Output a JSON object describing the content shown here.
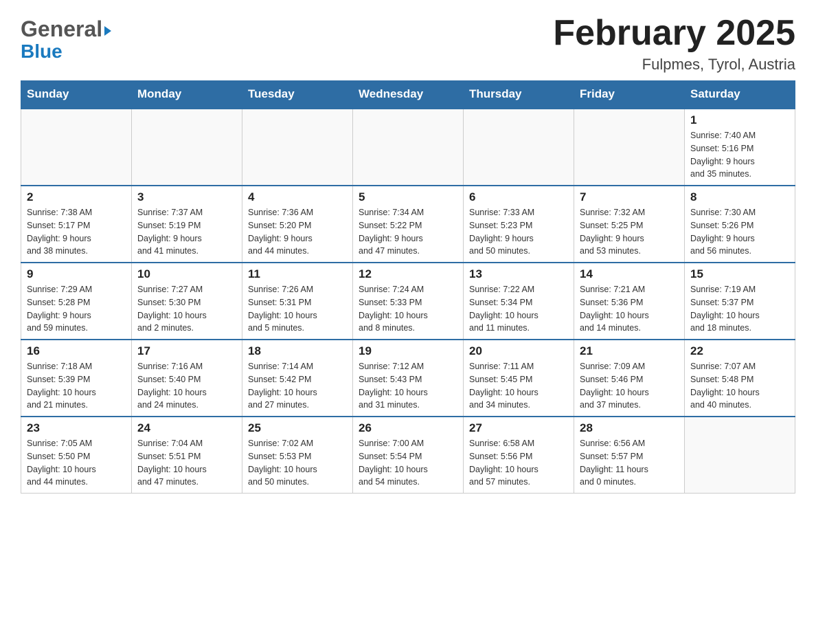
{
  "header": {
    "logo_line1": "General",
    "logo_arrow": "▶",
    "logo_line2": "Blue",
    "month_year": "February 2025",
    "location": "Fulpmes, Tyrol, Austria"
  },
  "days_of_week": [
    "Sunday",
    "Monday",
    "Tuesday",
    "Wednesday",
    "Thursday",
    "Friday",
    "Saturday"
  ],
  "weeks": [
    [
      {
        "day": "",
        "info": ""
      },
      {
        "day": "",
        "info": ""
      },
      {
        "day": "",
        "info": ""
      },
      {
        "day": "",
        "info": ""
      },
      {
        "day": "",
        "info": ""
      },
      {
        "day": "",
        "info": ""
      },
      {
        "day": "1",
        "info": "Sunrise: 7:40 AM\nSunset: 5:16 PM\nDaylight: 9 hours\nand 35 minutes."
      }
    ],
    [
      {
        "day": "2",
        "info": "Sunrise: 7:38 AM\nSunset: 5:17 PM\nDaylight: 9 hours\nand 38 minutes."
      },
      {
        "day": "3",
        "info": "Sunrise: 7:37 AM\nSunset: 5:19 PM\nDaylight: 9 hours\nand 41 minutes."
      },
      {
        "day": "4",
        "info": "Sunrise: 7:36 AM\nSunset: 5:20 PM\nDaylight: 9 hours\nand 44 minutes."
      },
      {
        "day": "5",
        "info": "Sunrise: 7:34 AM\nSunset: 5:22 PM\nDaylight: 9 hours\nand 47 minutes."
      },
      {
        "day": "6",
        "info": "Sunrise: 7:33 AM\nSunset: 5:23 PM\nDaylight: 9 hours\nand 50 minutes."
      },
      {
        "day": "7",
        "info": "Sunrise: 7:32 AM\nSunset: 5:25 PM\nDaylight: 9 hours\nand 53 minutes."
      },
      {
        "day": "8",
        "info": "Sunrise: 7:30 AM\nSunset: 5:26 PM\nDaylight: 9 hours\nand 56 minutes."
      }
    ],
    [
      {
        "day": "9",
        "info": "Sunrise: 7:29 AM\nSunset: 5:28 PM\nDaylight: 9 hours\nand 59 minutes."
      },
      {
        "day": "10",
        "info": "Sunrise: 7:27 AM\nSunset: 5:30 PM\nDaylight: 10 hours\nand 2 minutes."
      },
      {
        "day": "11",
        "info": "Sunrise: 7:26 AM\nSunset: 5:31 PM\nDaylight: 10 hours\nand 5 minutes."
      },
      {
        "day": "12",
        "info": "Sunrise: 7:24 AM\nSunset: 5:33 PM\nDaylight: 10 hours\nand 8 minutes."
      },
      {
        "day": "13",
        "info": "Sunrise: 7:22 AM\nSunset: 5:34 PM\nDaylight: 10 hours\nand 11 minutes."
      },
      {
        "day": "14",
        "info": "Sunrise: 7:21 AM\nSunset: 5:36 PM\nDaylight: 10 hours\nand 14 minutes."
      },
      {
        "day": "15",
        "info": "Sunrise: 7:19 AM\nSunset: 5:37 PM\nDaylight: 10 hours\nand 18 minutes."
      }
    ],
    [
      {
        "day": "16",
        "info": "Sunrise: 7:18 AM\nSunset: 5:39 PM\nDaylight: 10 hours\nand 21 minutes."
      },
      {
        "day": "17",
        "info": "Sunrise: 7:16 AM\nSunset: 5:40 PM\nDaylight: 10 hours\nand 24 minutes."
      },
      {
        "day": "18",
        "info": "Sunrise: 7:14 AM\nSunset: 5:42 PM\nDaylight: 10 hours\nand 27 minutes."
      },
      {
        "day": "19",
        "info": "Sunrise: 7:12 AM\nSunset: 5:43 PM\nDaylight: 10 hours\nand 31 minutes."
      },
      {
        "day": "20",
        "info": "Sunrise: 7:11 AM\nSunset: 5:45 PM\nDaylight: 10 hours\nand 34 minutes."
      },
      {
        "day": "21",
        "info": "Sunrise: 7:09 AM\nSunset: 5:46 PM\nDaylight: 10 hours\nand 37 minutes."
      },
      {
        "day": "22",
        "info": "Sunrise: 7:07 AM\nSunset: 5:48 PM\nDaylight: 10 hours\nand 40 minutes."
      }
    ],
    [
      {
        "day": "23",
        "info": "Sunrise: 7:05 AM\nSunset: 5:50 PM\nDaylight: 10 hours\nand 44 minutes."
      },
      {
        "day": "24",
        "info": "Sunrise: 7:04 AM\nSunset: 5:51 PM\nDaylight: 10 hours\nand 47 minutes."
      },
      {
        "day": "25",
        "info": "Sunrise: 7:02 AM\nSunset: 5:53 PM\nDaylight: 10 hours\nand 50 minutes."
      },
      {
        "day": "26",
        "info": "Sunrise: 7:00 AM\nSunset: 5:54 PM\nDaylight: 10 hours\nand 54 minutes."
      },
      {
        "day": "27",
        "info": "Sunrise: 6:58 AM\nSunset: 5:56 PM\nDaylight: 10 hours\nand 57 minutes."
      },
      {
        "day": "28",
        "info": "Sunrise: 6:56 AM\nSunset: 5:57 PM\nDaylight: 11 hours\nand 0 minutes."
      },
      {
        "day": "",
        "info": ""
      }
    ]
  ]
}
